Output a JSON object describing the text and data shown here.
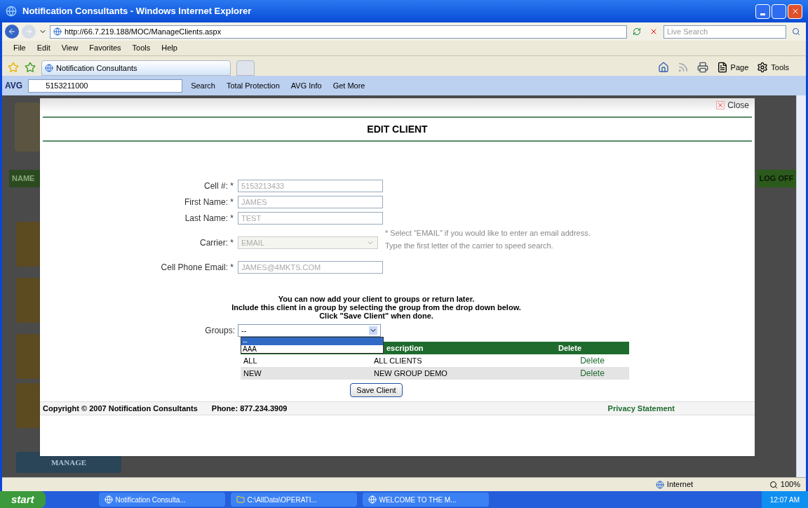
{
  "window": {
    "title": "Notification Consultants - Windows Internet Explorer"
  },
  "address_bar": {
    "url": "http://66.7.219.188/MOC/ManageClients.aspx",
    "search_placeholder": "Live Search"
  },
  "menu": [
    "File",
    "Edit",
    "View",
    "Favorites",
    "Tools",
    "Help"
  ],
  "tabs": [
    {
      "label": "Notification Consultants",
      "selected": true
    },
    {
      "selected": false
    }
  ],
  "command_bar": [
    "Page",
    "Tools"
  ],
  "avg_toolbar": {
    "brand": "AVG",
    "search_value": "5153211000",
    "items": [
      "Search",
      "Total Protection",
      "AVG Info",
      "Get More"
    ]
  },
  "background_page": {
    "name_bar": "NAME",
    "log_off": "LOG OFF",
    "manage_button": "MANAGE"
  },
  "modal": {
    "close": "Close",
    "title": "EDIT CLIENT",
    "fields": [
      {
        "label": "Cell #:",
        "value": "5153213433",
        "kind": "text",
        "disabled": true
      },
      {
        "label": "First Name:",
        "value": "JAMES",
        "kind": "text",
        "disabled": true
      },
      {
        "label": "Last Name:",
        "value": "TEST",
        "kind": "text",
        "disabled": true
      },
      {
        "label": "Carrier:",
        "value": "EMAIL",
        "kind": "select",
        "disabled": true
      },
      {
        "label": "Cell Phone Email:",
        "value": "JAMES@4MKTS.COM",
        "kind": "text",
        "disabled": true
      }
    ],
    "required_mark": "*",
    "carrier_hint": [
      "* Select \"EMAIL\" if you would like to enter an email address.",
      "Type the first letter of the carrier to speed search."
    ],
    "instructions": [
      "You can now add your client to groups or return later.",
      "Include this client in a group by selecting the group from the drop down below.",
      "Click \"Save Client\" when done."
    ],
    "groups": {
      "label": "Groups:",
      "value": "--",
      "options": [
        {
          "label": "--",
          "selected": true
        },
        {
          "label": "AAA",
          "selected": false
        }
      ]
    },
    "table": {
      "columns": [
        null,
        "escription",
        "Delete"
      ],
      "rows": [
        [
          "ALL",
          "ALL CLIENTS",
          "Delete"
        ],
        [
          "NEW",
          "NEW GROUP DEMO",
          "Delete"
        ]
      ]
    },
    "save_button": "Save Client",
    "footer": {
      "copyright": "Copyright © 2007 Notification Consultants",
      "phone": "Phone: 877.234.3909",
      "privacy": "Privacy Statement"
    }
  },
  "status_bar": {
    "zone": "Internet",
    "zoom": "100%"
  },
  "taskbar": {
    "start": "start",
    "items": [
      "Notification Consulta...",
      "C:\\AllData\\OPERATI...",
      "WELCOME TO THE M..."
    ],
    "clock": "12:07 AM"
  }
}
